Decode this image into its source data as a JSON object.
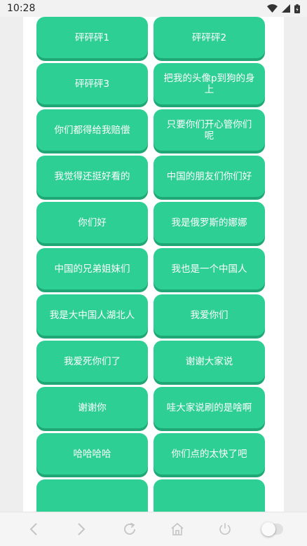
{
  "status_bar": {
    "time": "10:28"
  },
  "buttons": [
    "",
    "",
    "砰砰砰1",
    "砰砰砰2",
    "砰砰砰3",
    "把我的头像p到狗的身上",
    "你们都得给我赔偿",
    "只要你们开心管你们呢",
    "我觉得还挺好看的",
    "中国的朋友们你们好",
    "你们好",
    "我是俄罗斯的娜娜",
    "中国的兄弟姐妹们",
    "我也是一个中国人",
    "我是大中国人湖北人",
    "我爱你们",
    "我爱死你们了",
    "谢谢大家说",
    "谢谢你",
    "哇大家说刷的是啥啊",
    "哈哈哈哈",
    "你们点的太快了吧",
    "",
    ""
  ],
  "colors": {
    "button": "#2ecf95",
    "button_shadow": "#1fa876"
  },
  "nav_bar": {
    "toggle_on": false
  }
}
